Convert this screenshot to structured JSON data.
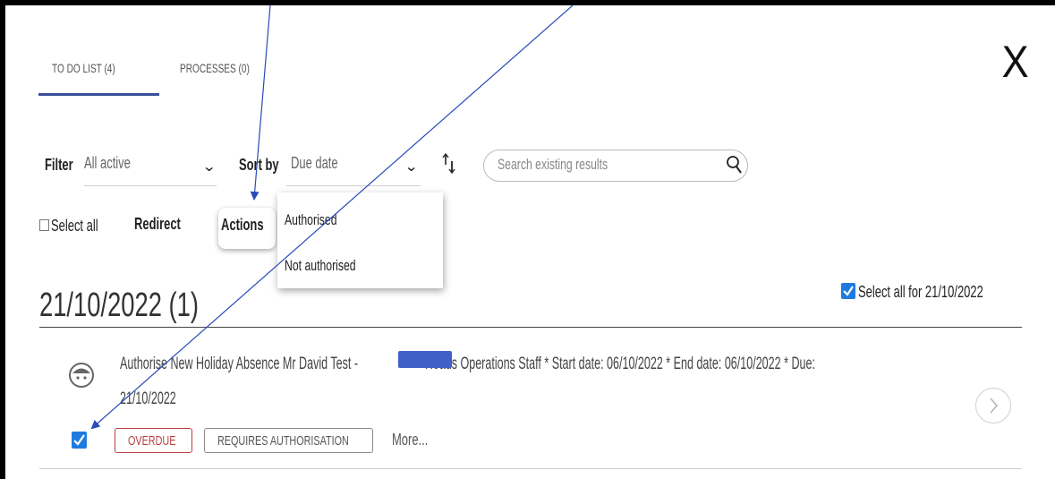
{
  "tabs": [
    {
      "label": "TO DO LIST (4)",
      "active": true
    },
    {
      "label": "PROCESSES (0)",
      "active": false
    }
  ],
  "close_label": "X",
  "toolbar": {
    "filter_label": "Filter",
    "filter_value": "All active",
    "sort_label": "Sort by",
    "sort_value": "Due date",
    "sort_direction_icon": "sort-direction-icon",
    "search_placeholder": "Search existing results",
    "select_all_label": "Select all",
    "redirect_label": "Redirect",
    "actions_label": "Actions"
  },
  "actions_menu": {
    "items": [
      "Authorised",
      "Not authorised"
    ]
  },
  "group": {
    "date_heading": "21/10/2022 (1)",
    "select_all_for_label": "Select all for 21/10/2022",
    "select_all_checked": true
  },
  "task": {
    "text_line1_prefix": "Authorise New Holiday Absence Mr David Test - ",
    "text_line1_suffix": " * Roads Operations Staff * Start date: 06/10/2022 * End date: 06/10/2022 * Due:",
    "text_line2": "21/10/2022",
    "checked": true,
    "badges": [
      "OVERDUE",
      "REQUIRES AUTHORISATION"
    ],
    "more_label": "More..."
  },
  "colors": {
    "accent": "#3a4f9a",
    "checkbox": "#1e7be0",
    "overdue": "#b94040",
    "annotation_arrow": "#2a4bb8"
  }
}
